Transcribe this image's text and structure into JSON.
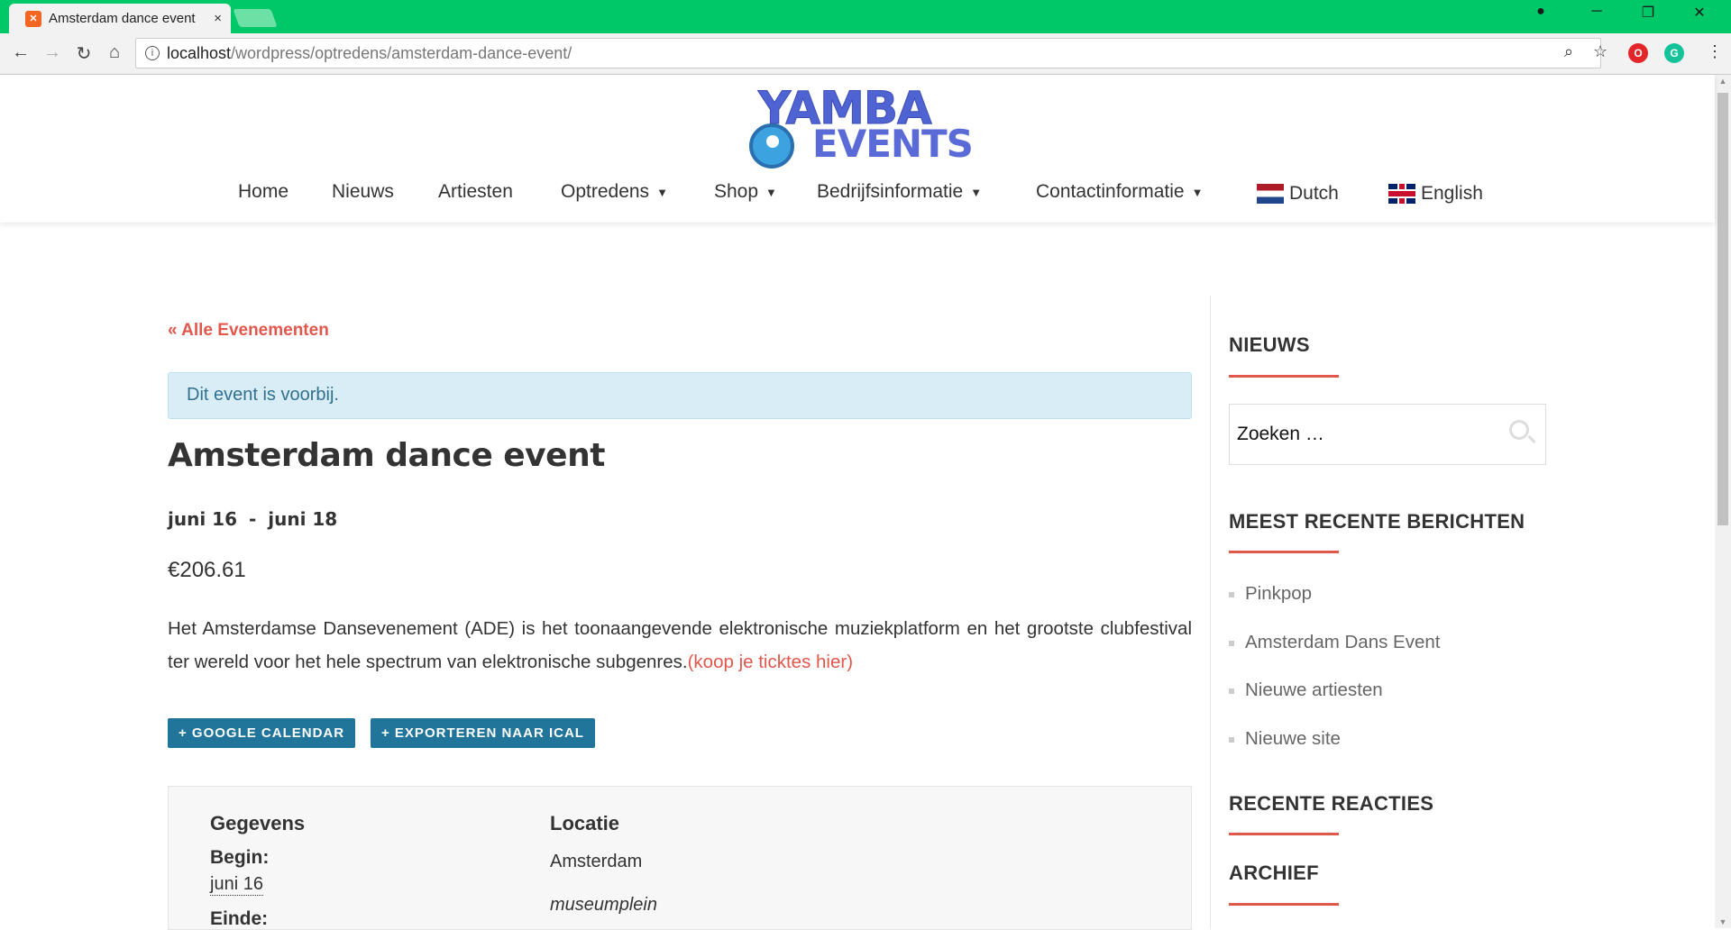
{
  "browser": {
    "tab_title": "Amsterdam dance event",
    "tab_close": "×",
    "url_host": "localhost",
    "url_path": "/wordpress/optredens/amsterdam-dance-event/",
    "theme_color": "#00c868"
  },
  "site": {
    "logo_line1": "YAMBA",
    "logo_line2": "EVENTS",
    "menu": [
      {
        "label": "Home"
      },
      {
        "label": "Nieuws"
      },
      {
        "label": "Artiesten"
      },
      {
        "label": "Optredens",
        "dropdown": true
      },
      {
        "label": "Shop",
        "dropdown": true
      },
      {
        "label": "Bedrijfsinformatie",
        "dropdown": true
      },
      {
        "label": "Contactinformatie",
        "dropdown": true
      },
      {
        "label": "Dutch",
        "flag": "nl"
      },
      {
        "label": "English",
        "flag": "gb"
      }
    ]
  },
  "event": {
    "back_link": "« Alle Evenementen",
    "notice": "Dit event is voorbij.",
    "title": "Amsterdam dance event",
    "date_start": "juni 16",
    "date_sep": "-",
    "date_end": "juni 18",
    "price": "€206.61",
    "description": "Het Amsterdamse Dansevenement (ADE) is het toonaangevende elektronische muziekplatform en het grootste clubfestival ter wereld voor het hele spectrum van elektronische subgenres.",
    "ticket_link": "(koop je ticktes hier)",
    "btn_google": "+ GOOGLE CALENDAR",
    "btn_ical": "+ EXPORTEREN NAAR ICAL",
    "details": {
      "heading": "Gegevens",
      "begin_label": "Begin:",
      "begin_value": "juni 16",
      "end_label": "Einde:",
      "location_heading": "Locatie",
      "location_name": "Amsterdam",
      "location_address": "museumplein"
    }
  },
  "sidebar": {
    "news_title": "NIEUWS",
    "search_placeholder": "Zoeken …",
    "recent_posts_title": "MEEST RECENTE BERICHTEN",
    "recent_posts": [
      "Pinkpop",
      "Amsterdam Dans Event",
      "Nieuwe artiesten",
      "Nieuwe site"
    ],
    "recent_comments_title": "RECENTE REACTIES",
    "archive_title": "ARCHIEF",
    "accent_color": "#e2574c"
  }
}
